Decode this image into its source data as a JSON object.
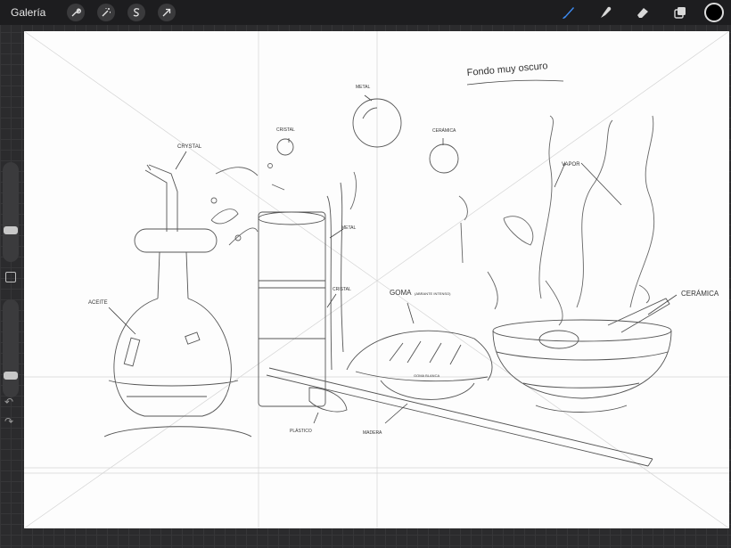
{
  "app": {
    "gallery_label": "Galería",
    "left_tools": [
      "wrench-icon",
      "magic-wand-icon",
      "selection-s-icon",
      "transform-arrow-icon"
    ],
    "right_tools": [
      "brush-icon",
      "smudge-icon",
      "eraser-icon",
      "layers-icon"
    ],
    "active_tool": "brush",
    "accent_color": "#3d8bf2",
    "current_color": "#000000"
  },
  "sidebar": {
    "brush_size_level": 0.3,
    "opacity_level": 0.2
  },
  "drawing": {
    "title": "Fondo muy oscuro",
    "labels": {
      "cristal_top": "CRYSTAL",
      "cristal_small": "CRISTAL",
      "metal_top": "METAL",
      "ceramica_top": "CERÁMICA",
      "vapor": "VAPOR",
      "aceite": "ACEITE",
      "metal_side": "METAL",
      "cristal_side": "CRISTAL",
      "goma": "GOMA",
      "goma_note": "(ABRANTE INTENSO)",
      "ceramica_right": "CERÁMICA",
      "goma_blanca": "GOMA BLANCA",
      "plastico": "PLÁSTICO",
      "madera": "MADERA"
    }
  }
}
